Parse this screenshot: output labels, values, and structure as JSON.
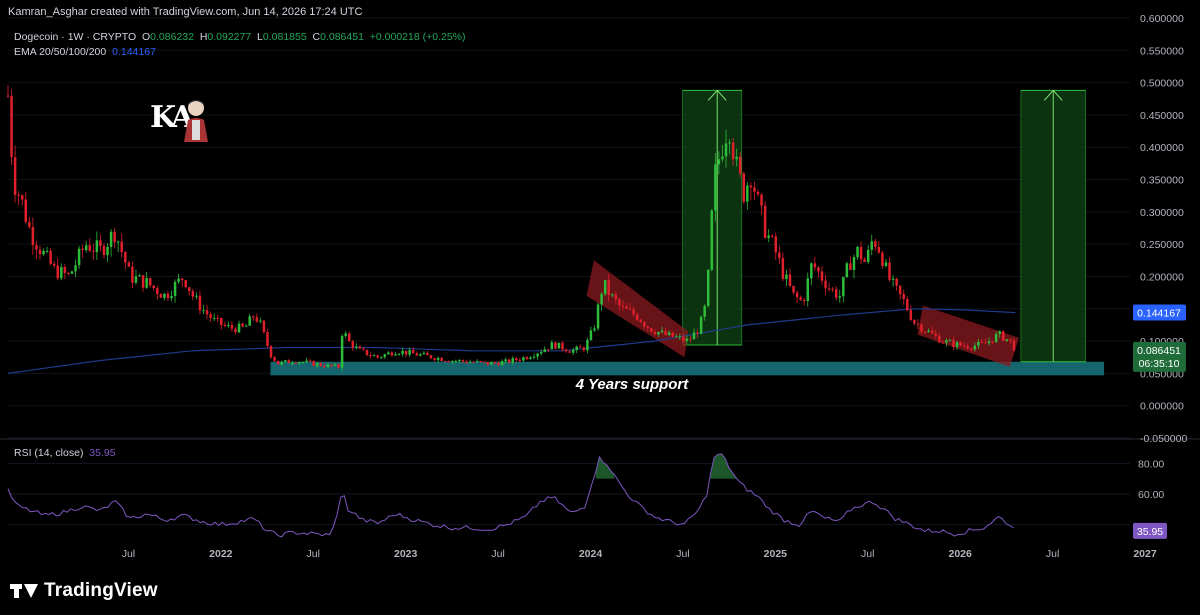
{
  "header": {
    "attribution": "Kamran_Asghar created with TradingView.com, Jun 14, 2026 17:24 UTC"
  },
  "legend": {
    "symbol": "Dogecoin · 1W · CRYPTO",
    "open_label": "O",
    "open": "0.086232",
    "high_label": "H",
    "high": "0.092277",
    "low_label": "L",
    "low": "0.081855",
    "close_label": "C",
    "close": "0.086451",
    "change": "+0.000218 (+0.25%)",
    "ema_label": "EMA 20/50/100/200",
    "ema_value": "0.144167"
  },
  "annotation": {
    "support_text": "4 Years support"
  },
  "watermark": {
    "brand": "TradingView",
    "author_logo_text": "KA"
  },
  "price_tags": {
    "ema": "0.144167",
    "last": "0.086451",
    "countdown": "06:35:10"
  },
  "rsi": {
    "label": "RSI (14, close)",
    "value": "35.95"
  },
  "colors": {
    "bull": "#2ebd3a",
    "bear": "#e0202a",
    "ema": "#1e3a8a",
    "support_band": "#17707a",
    "target_box": "#0f3d12",
    "channel": "#8b1a1f",
    "rsi_line": "#7e57c2",
    "last_tag": "#1f6b3a",
    "ema_tag": "#2962ff"
  },
  "chart_data": [
    {
      "type": "candlestick",
      "title": "",
      "xlabel": "",
      "ylabel": "",
      "ylim": [
        -0.05,
        0.6
      ],
      "y_ticks": [
        "-0.050000",
        "0.000000",
        "0.050000",
        "0.100000",
        "0.150000",
        "0.200000",
        "0.250000",
        "0.300000",
        "0.350000",
        "0.400000",
        "0.450000",
        "0.500000",
        "0.550000",
        "0.600000"
      ],
      "x_ticks": [
        {
          "label": "Jul",
          "t": 2021.5
        },
        {
          "label": "2022",
          "t": 2022.0
        },
        {
          "label": "Jul",
          "t": 2022.5
        },
        {
          "label": "2023",
          "t": 2023.0
        },
        {
          "label": "Jul",
          "t": 2023.5
        },
        {
          "label": "2024",
          "t": 2024.0
        },
        {
          "label": "Jul",
          "t": 2024.5
        },
        {
          "label": "2025",
          "t": 2025.0
        },
        {
          "label": "Jul",
          "t": 2025.5
        },
        {
          "label": "2026",
          "t": 2026.0
        },
        {
          "label": "Jul",
          "t": 2026.5
        },
        {
          "label": "2027",
          "t": 2027.0
        }
      ],
      "close_path": [
        [
          2021.0,
          0.48
        ],
        [
          2021.03,
          0.35
        ],
        [
          2021.07,
          0.32
        ],
        [
          2021.12,
          0.27
        ],
        [
          2021.18,
          0.24
        ],
        [
          2021.25,
          0.21
        ],
        [
          2021.33,
          0.2
        ],
        [
          2021.42,
          0.25
        ],
        [
          2021.5,
          0.24
        ],
        [
          2021.58,
          0.27
        ],
        [
          2021.66,
          0.2
        ],
        [
          2021.75,
          0.19
        ],
        [
          2021.85,
          0.17
        ],
        [
          2021.95,
          0.2
        ],
        [
          2022.0,
          0.17
        ],
        [
          2022.05,
          0.15
        ],
        [
          2022.12,
          0.13
        ],
        [
          2022.2,
          0.12
        ],
        [
          2022.28,
          0.12
        ],
        [
          2022.33,
          0.14
        ],
        [
          2022.36,
          0.13
        ],
        [
          2022.42,
          0.08
        ],
        [
          2022.46,
          0.065
        ],
        [
          2022.55,
          0.07
        ],
        [
          2022.65,
          0.065
        ],
        [
          2022.72,
          0.062
        ],
        [
          2022.79,
          0.06
        ],
        [
          2022.81,
          0.12
        ],
        [
          2022.84,
          0.1
        ],
        [
          2022.9,
          0.085
        ],
        [
          2023.0,
          0.075
        ],
        [
          2023.1,
          0.085
        ],
        [
          2023.2,
          0.08
        ],
        [
          2023.3,
          0.075
        ],
        [
          2023.4,
          0.07
        ],
        [
          2023.5,
          0.068
        ],
        [
          2023.6,
          0.065
        ],
        [
          2023.7,
          0.068
        ],
        [
          2023.8,
          0.075
        ],
        [
          2023.88,
          0.085
        ],
        [
          2023.95,
          0.095
        ],
        [
          2024.05,
          0.085
        ],
        [
          2024.12,
          0.09
        ],
        [
          2024.17,
          0.12
        ],
        [
          2024.22,
          0.19
        ],
        [
          2024.26,
          0.17
        ],
        [
          2024.32,
          0.15
        ],
        [
          2024.4,
          0.14
        ],
        [
          2024.47,
          0.12
        ],
        [
          2024.55,
          0.11
        ],
        [
          2024.62,
          0.105
        ],
        [
          2024.68,
          0.1
        ],
        [
          2024.74,
          0.12
        ],
        [
          2024.78,
          0.16
        ],
        [
          2024.82,
          0.35
        ],
        [
          2024.86,
          0.4
        ],
        [
          2024.9,
          0.44
        ],
        [
          2024.94,
          0.37
        ],
        [
          2024.98,
          0.33
        ],
        [
          2025.02,
          0.36
        ],
        [
          2025.06,
          0.31
        ],
        [
          2025.1,
          0.27
        ],
        [
          2025.15,
          0.24
        ],
        [
          2025.2,
          0.2
        ],
        [
          2025.25,
          0.17
        ],
        [
          2025.3,
          0.16
        ],
        [
          2025.35,
          0.22
        ],
        [
          2025.4,
          0.2
        ],
        [
          2025.45,
          0.18
        ],
        [
          2025.5,
          0.17
        ],
        [
          2025.55,
          0.22
        ],
        [
          2025.6,
          0.24
        ],
        [
          2025.64,
          0.22
        ],
        [
          2025.68,
          0.26
        ],
        [
          2025.72,
          0.24
        ],
        [
          2025.76,
          0.2
        ],
        [
          2025.8,
          0.18
        ],
        [
          2025.85,
          0.16
        ],
        [
          2025.9,
          0.13
        ],
        [
          2025.95,
          0.12
        ],
        [
          2026.0,
          0.11
        ],
        [
          2026.06,
          0.1
        ],
        [
          2026.12,
          0.095
        ],
        [
          2026.2,
          0.092
        ],
        [
          2026.28,
          0.095
        ],
        [
          2026.36,
          0.11
        ],
        [
          2026.42,
          0.1
        ],
        [
          2026.45,
          0.0865
        ]
      ]
    },
    {
      "type": "line",
      "title": "",
      "series": [
        {
          "name": "RSI (14, close)"
        }
      ],
      "ylim": [
        30,
        90
      ],
      "y_ticks": [
        "60.00",
        "80.00"
      ],
      "path": [
        [
          2021.0,
          62
        ],
        [
          2021.05,
          52
        ],
        [
          2021.1,
          50
        ],
        [
          2021.2,
          46
        ],
        [
          2021.3,
          48
        ],
        [
          2021.4,
          52
        ],
        [
          2021.5,
          49
        ],
        [
          2021.58,
          55
        ],
        [
          2021.66,
          44
        ],
        [
          2021.75,
          47
        ],
        [
          2021.85,
          43
        ],
        [
          2021.95,
          46
        ],
        [
          2022.05,
          42
        ],
        [
          2022.15,
          40
        ],
        [
          2022.25,
          42
        ],
        [
          2022.33,
          44
        ],
        [
          2022.4,
          36
        ],
        [
          2022.46,
          33
        ],
        [
          2022.55,
          35
        ],
        [
          2022.65,
          34
        ],
        [
          2022.75,
          33
        ],
        [
          2022.81,
          62
        ],
        [
          2022.84,
          50
        ],
        [
          2022.92,
          43
        ],
        [
          2023.0,
          41
        ],
        [
          2023.1,
          47
        ],
        [
          2023.2,
          43
        ],
        [
          2023.3,
          40
        ],
        [
          2023.4,
          38
        ],
        [
          2023.5,
          38
        ],
        [
          2023.6,
          37
        ],
        [
          2023.7,
          40
        ],
        [
          2023.8,
          45
        ],
        [
          2023.88,
          55
        ],
        [
          2023.95,
          58
        ],
        [
          2024.05,
          47
        ],
        [
          2024.12,
          52
        ],
        [
          2024.17,
          72
        ],
        [
          2024.2,
          83
        ],
        [
          2024.24,
          80
        ],
        [
          2024.28,
          72
        ],
        [
          2024.35,
          60
        ],
        [
          2024.42,
          52
        ],
        [
          2024.5,
          45
        ],
        [
          2024.58,
          42
        ],
        [
          2024.66,
          40
        ],
        [
          2024.74,
          50
        ],
        [
          2024.78,
          60
        ],
        [
          2024.82,
          84
        ],
        [
          2024.86,
          86
        ],
        [
          2024.9,
          78
        ],
        [
          2024.95,
          68
        ],
        [
          2025.0,
          63
        ],
        [
          2025.06,
          58
        ],
        [
          2025.12,
          50
        ],
        [
          2025.2,
          43
        ],
        [
          2025.28,
          40
        ],
        [
          2025.35,
          49
        ],
        [
          2025.42,
          44
        ],
        [
          2025.5,
          42
        ],
        [
          2025.56,
          50
        ],
        [
          2025.62,
          53
        ],
        [
          2025.68,
          55
        ],
        [
          2025.74,
          50
        ],
        [
          2025.8,
          44
        ],
        [
          2025.88,
          40
        ],
        [
          2025.96,
          36
        ],
        [
          2026.04,
          36
        ],
        [
          2026.12,
          34
        ],
        [
          2026.2,
          36
        ],
        [
          2026.28,
          38
        ],
        [
          2026.36,
          45
        ],
        [
          2026.42,
          40
        ],
        [
          2026.45,
          35.95
        ]
      ]
    }
  ]
}
